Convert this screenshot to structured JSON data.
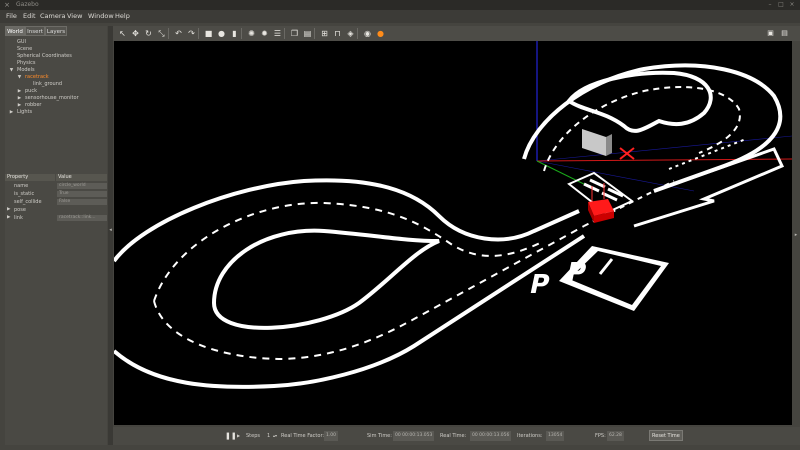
{
  "window": {
    "title": "Gazebo",
    "close_glyph": "×",
    "min_glyph": "–",
    "max_glyph": "□",
    "x_glyph": "×"
  },
  "menubar": {
    "items": [
      "File",
      "Edit",
      "Camera",
      "View",
      "Window",
      "Help"
    ]
  },
  "left_panel": {
    "tabs": [
      "World",
      "Insert",
      "Layers"
    ],
    "tree": {
      "items": [
        {
          "label": "GUI",
          "indent": 0,
          "arrow": ""
        },
        {
          "label": "Scene",
          "indent": 0,
          "arrow": ""
        },
        {
          "label": "Spherical Coordinates",
          "indent": 0,
          "arrow": ""
        },
        {
          "label": "Physics",
          "indent": 0,
          "arrow": ""
        },
        {
          "label": "Models",
          "indent": 0,
          "arrow": "▼"
        },
        {
          "label": "racetrack",
          "indent": 1,
          "arrow": "▼",
          "selected": true
        },
        {
          "label": "link_ground",
          "indent": 2,
          "arrow": ""
        },
        {
          "label": "puck",
          "indent": 1,
          "arrow": "▶"
        },
        {
          "label": "sensorhouse_monitor",
          "indent": 1,
          "arrow": "▶"
        },
        {
          "label": "robber",
          "indent": 1,
          "arrow": "▶"
        },
        {
          "label": "Lights",
          "indent": 0,
          "arrow": "▶"
        }
      ]
    },
    "properties": {
      "header_property": "Property",
      "header_value": "Value",
      "rows": [
        {
          "key": "name",
          "value": "circle_world",
          "expand": ""
        },
        {
          "key": "is_static",
          "value": "True",
          "expand": ""
        },
        {
          "key": "self_collide",
          "value": "False",
          "expand": ""
        },
        {
          "key": "pose",
          "value": "",
          "expand": "▶"
        },
        {
          "key": "link",
          "value": "racetrack::link...",
          "expand": "▶"
        }
      ]
    }
  },
  "toolbar": {
    "icons": [
      "select-arrow-icon",
      "translate-icon",
      "rotate-icon",
      "scale-icon",
      "undo-icon",
      "redo-icon",
      "box-icon",
      "sphere-icon",
      "cylinder-icon",
      "point-light-icon",
      "spot-light-icon",
      "directional-light-icon",
      "copy-icon",
      "paste-icon",
      "align-icon",
      "snap-icon",
      "change-view-icon",
      "screenshot-icon",
      "record-icon"
    ]
  },
  "bottom_bar": {
    "pause_glyph": "❚❚",
    "steps_label": "Steps",
    "steps_value": "1",
    "real_time_factor_label": "Real Time Factor:",
    "real_time_factor_value": "1.00",
    "sim_time_label": "Sim Time:",
    "sim_time_value": "00 00:00:13.053",
    "real_time_label": "Real Time:",
    "real_time_value": "00 00:00:13.056",
    "iterations_label": "Iterations:",
    "iterations_value": "13054",
    "fps_label": "FPS:",
    "fps_value": "62.28",
    "reset_time_label": "Reset Time"
  },
  "colors": {
    "accent_orange": "#ff8c1a",
    "track_white": "#ffffff",
    "ground": "#000000",
    "car_red": "#ff1a1a"
  }
}
